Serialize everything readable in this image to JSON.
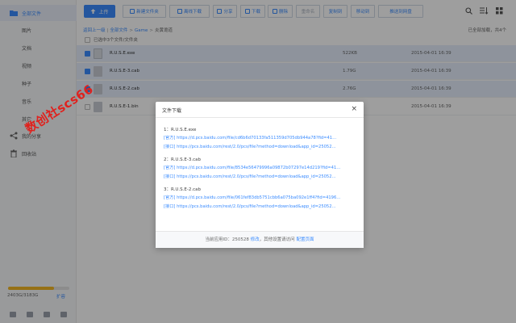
{
  "sidebar": {
    "items": [
      {
        "label": "全部文件",
        "icon": "folder-icon",
        "active": true
      },
      {
        "label": "图片"
      },
      {
        "label": "文档"
      },
      {
        "label": "视频"
      },
      {
        "label": "种子"
      },
      {
        "label": "音乐"
      },
      {
        "label": "其它"
      },
      {
        "label": "我的分享",
        "icon": "share-icon"
      },
      {
        "label": "回收站",
        "icon": "trash-icon"
      }
    ],
    "quota": {
      "text": "2403G/3183G",
      "expand": "扩容",
      "fraction": 0.755,
      "color": "#f2b624"
    }
  },
  "toolbar": {
    "upload": "上传",
    "new_folder": "新建文件夹",
    "offline": "离线下载",
    "share": "分享",
    "download": "下载",
    "delete": "删除",
    "rename": "重命名",
    "copy": "复制到",
    "move": "移动到",
    "push": "推送到网盘"
  },
  "breadcrumb": {
    "back": "返回上一级",
    "all": "全部文件",
    "game": "Game",
    "current": "炎黄诡道"
  },
  "loaded_text": "已全部加载，共4个",
  "select_text": "已选中3个文件/文件夹",
  "files": [
    {
      "name": "R.U.S.E.exe",
      "size": "522KB",
      "date": "2015-04-01 16:39",
      "selected": true
    },
    {
      "name": "R.U.S.E-3.cab",
      "size": "1.79G",
      "date": "2015-04-01 16:39",
      "selected": true
    },
    {
      "name": "R.U.S.E-2.cab",
      "size": "2.76G",
      "date": "2015-04-01 16:39",
      "selected": true
    },
    {
      "name": "R.U.S.E-1.bin",
      "size": "",
      "date": "2015-04-01 16:39",
      "selected": false
    }
  ],
  "dialog": {
    "title": "文件下载",
    "close": "×",
    "groups": [
      {
        "title": "1：R.U.S.E.exe",
        "official": "[官方] https://d.pcs.baidu.com/file/cd6b6d70133fa511359d705db944a78?fid=41…",
        "api": "[接口] https://pcs.baidu.com/rest/2.0/pcs/file?method=download&app_id=25052…"
      },
      {
        "title": "2：R.U.S.E-3.cab",
        "official": "[官方] https://d.pcs.baidu.com/file/8534e56479996a09872b07297e14d219?fid=41…",
        "api": "[接口] https://pcs.baidu.com/rest/2.0/pcs/file?method=download&app_id=25052…"
      },
      {
        "title": "3：R.U.S.E-2.cab",
        "official": "[官方] https://d.pcs.baidu.com/file/061fef83db5751cbb6a075ba092e1ff4?fid=4196…",
        "api": "[接口] https://pcs.baidu.com/rest/2.0/pcs/file?method=download&app_id=25052…"
      }
    ],
    "footer_prefix": "当前应用ID：250528",
    "footer_modify": "修改",
    "footer_mid": "，其他设置请访问",
    "footer_link": "配置页面"
  },
  "watermark": "数创社scs66"
}
